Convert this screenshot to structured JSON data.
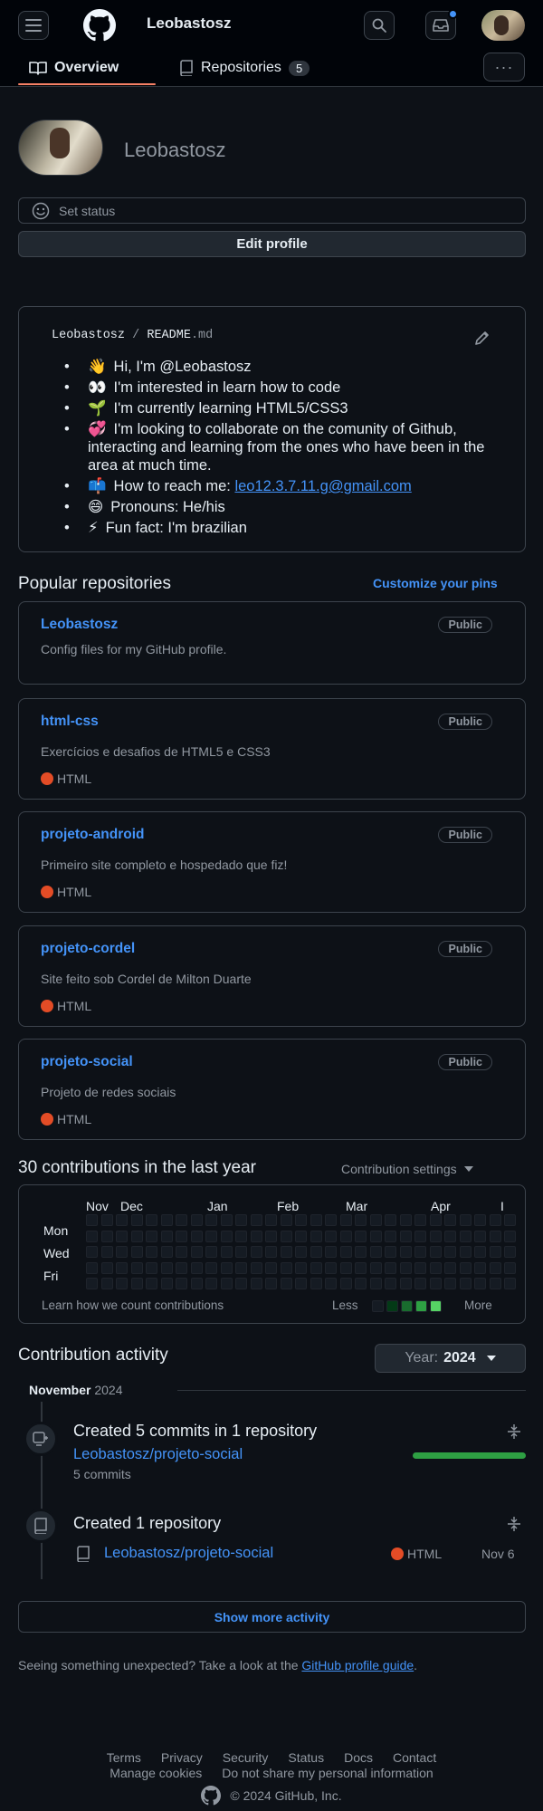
{
  "header": {
    "username": "Leobastosz",
    "icons": [
      "menu-icon",
      "github-logo-icon",
      "search-icon",
      "inbox-icon",
      "avatar"
    ]
  },
  "tabs": [
    {
      "label": "Overview",
      "icon": "book-icon"
    },
    {
      "label": "Repositories",
      "icon": "repo-icon",
      "count": "5"
    }
  ],
  "profile": {
    "display_name": "Leobastosz",
    "status_placeholder": "Set status",
    "edit_label": "Edit profile"
  },
  "readme": {
    "owner": "Leobastosz",
    "separator": "/",
    "file": "README",
    "ext": ".md",
    "items": [
      {
        "emoji": "👋",
        "text": "Hi, I'm @Leobastosz"
      },
      {
        "emoji": "👀",
        "text": "I'm interested in learn how to code"
      },
      {
        "emoji": "🌱",
        "text": "I'm currently learning HTML5/CSS3"
      },
      {
        "emoji": "💞️",
        "text": "I'm looking to collaborate on the comunity of Github, interacting and learning from the ones who have been in the area at much time."
      },
      {
        "emoji": "📫",
        "text": "How to reach me:",
        "link": "leo12.3.7.11.g@gmail.com"
      },
      {
        "emoji": "😄",
        "text": "Pronouns: He/his"
      },
      {
        "emoji": "⚡",
        "text": "Fun fact: I'm brazilian"
      }
    ]
  },
  "popular": {
    "title": "Popular repositories",
    "customize": "Customize your pins",
    "repos": [
      {
        "name": "Leobastosz",
        "visibility": "Public",
        "description": "Config files for my GitHub profile.",
        "language": ""
      },
      {
        "name": "html-css",
        "visibility": "Public",
        "description": "Exercícios e desafios de HTML5 e CSS3",
        "language": "HTML"
      },
      {
        "name": "projeto-android",
        "visibility": "Public",
        "description": "Primeiro site completo e hospedado que fiz!",
        "language": "HTML"
      },
      {
        "name": "projeto-cordel",
        "visibility": "Public",
        "description": "Site feito sob Cordel de Milton Duarte",
        "language": "HTML"
      },
      {
        "name": "projeto-social",
        "visibility": "Public",
        "description": "Projeto de redes sociais",
        "language": "HTML"
      }
    ]
  },
  "contributions": {
    "title": "30 contributions in the last year",
    "settings": "Contribution settings",
    "months": [
      "Nov",
      "Dec",
      "Jan",
      "Feb",
      "Mar",
      "Apr",
      "I"
    ],
    "days": [
      "Mon",
      "Wed",
      "Fri"
    ],
    "learn": "Learn how we count contributions",
    "less": "Less",
    "more": "More",
    "legend_colors": [
      "#151b23",
      "#033a16",
      "#196c2e",
      "#2ea043",
      "#56d364"
    ]
  },
  "activity": {
    "title": "Contribution activity",
    "year_label": "Year:",
    "year": "2024",
    "month": "November",
    "month_year": "2024",
    "events": [
      {
        "title": "Created 5 commits in 1 repository",
        "repo": "Leobastosz/projeto-social",
        "sub": "5 commits",
        "progress": 1.0
      },
      {
        "title": "Created 1 repository",
        "repo": "Leobastosz/projeto-social",
        "language": "HTML",
        "date": "Nov 6"
      }
    ],
    "show_more": "Show more activity"
  },
  "notice": {
    "text": "Seeing something unexpected? Take a look at the",
    "link": "GitHub profile guide",
    "end": "."
  },
  "footer": {
    "row1": [
      "Terms",
      "Privacy",
      "Security",
      "Status",
      "Docs",
      "Contact"
    ],
    "row2": [
      "Manage cookies",
      "Do not share my personal information"
    ],
    "copyright": "© 2024 GitHub, Inc."
  },
  "colors": {
    "background": "#0d1117",
    "accent": "#4493f8",
    "html_language": "#e34c26",
    "tab_underline": "#f78166",
    "progress": "#2ea043"
  }
}
